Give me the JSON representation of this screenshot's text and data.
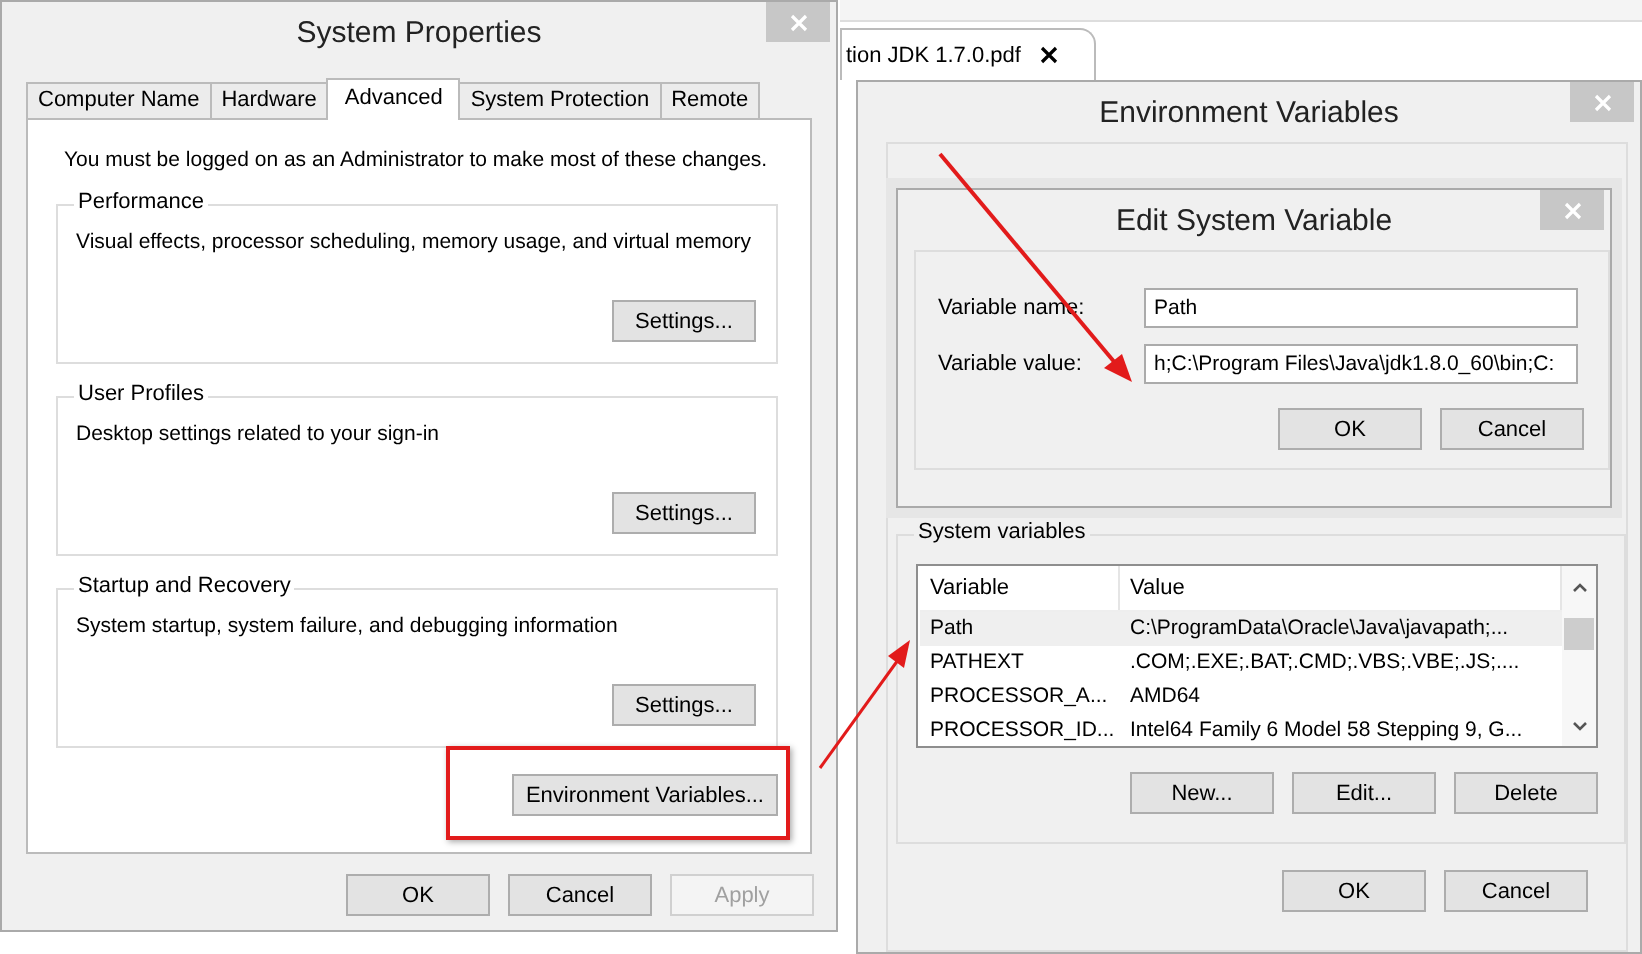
{
  "pdf_tab": {
    "label": "tion JDK 1.7.0.pdf"
  },
  "system_properties": {
    "title": "System Properties",
    "tabs": [
      {
        "label": "Computer Name",
        "selected": false
      },
      {
        "label": "Hardware",
        "selected": false
      },
      {
        "label": "Advanced",
        "selected": true
      },
      {
        "label": "System Protection",
        "selected": false
      },
      {
        "label": "Remote",
        "selected": false
      }
    ],
    "admin_note": "You must be logged on as an Administrator to make most of these changes.",
    "groups": [
      {
        "title": "Performance",
        "description": "Visual effects, processor scheduling, memory usage, and virtual memory",
        "button": "Settings..."
      },
      {
        "title": "User Profiles",
        "description": "Desktop settings related to your sign-in",
        "button": "Settings..."
      },
      {
        "title": "Startup and Recovery",
        "description": "System startup, system failure, and debugging information",
        "button": "Settings..."
      }
    ],
    "env_button": "Environment Variables...",
    "buttons": [
      {
        "label": "OK",
        "disabled": false
      },
      {
        "label": "Cancel",
        "disabled": false
      },
      {
        "label": "Apply",
        "disabled": true
      }
    ]
  },
  "environment_variables": {
    "title": "Environment Variables",
    "system_variables": {
      "title": "System variables",
      "columns": [
        "Variable",
        "Value"
      ],
      "rows": [
        {
          "variable": "Path",
          "value": "C:\\ProgramData\\Oracle\\Java\\javapath;...",
          "selected": true
        },
        {
          "variable": "PATHEXT",
          "value": ".COM;.EXE;.BAT;.CMD;.VBS;.VBE;.JS;....",
          "selected": false
        },
        {
          "variable": "PROCESSOR_A...",
          "value": "AMD64",
          "selected": false
        },
        {
          "variable": "PROCESSOR_ID...",
          "value": "Intel64 Family 6 Model 58 Stepping 9, G...",
          "selected": false
        }
      ],
      "buttons": [
        "New...",
        "Edit...",
        "Delete"
      ]
    },
    "buttons": [
      "OK",
      "Cancel"
    ]
  },
  "edit_system_variable": {
    "title": "Edit System Variable",
    "name_label": "Variable name:",
    "name_value": "Path",
    "value_label": "Variable value:",
    "value_value": "h;C:\\Program Files\\Java\\jdk1.8.0_60\\bin;C:",
    "buttons": [
      "OK",
      "Cancel"
    ]
  }
}
